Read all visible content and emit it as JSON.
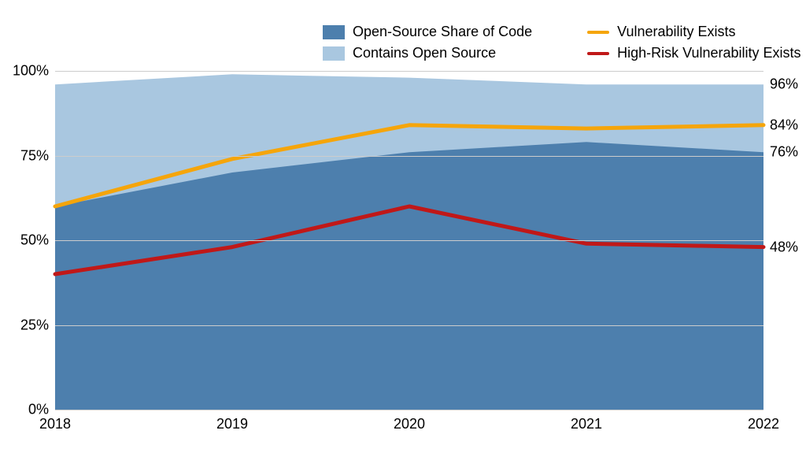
{
  "chart_data": {
    "type": "area",
    "x": [
      2018,
      2019,
      2020,
      2021,
      2022
    ],
    "series": [
      {
        "name": "Contains Open Source",
        "type": "area",
        "color": "#a9c7e0",
        "values": [
          96,
          99,
          98,
          96,
          96
        ]
      },
      {
        "name": "Open-Source Share of Code",
        "type": "area",
        "color": "#4d7fad",
        "values": [
          60,
          70,
          76,
          79,
          76
        ]
      },
      {
        "name": "Vulnerability Exists",
        "type": "line",
        "color": "#f5a50b",
        "values": [
          60,
          74,
          84,
          83,
          84
        ]
      },
      {
        "name": "High-Risk Vulnerability Exists",
        "type": "line",
        "color": "#c01818",
        "values": [
          40,
          48,
          60,
          49,
          48
        ]
      }
    ],
    "xlabel": "",
    "ylabel": "",
    "ylim": [
      0,
      100
    ],
    "xlim": [
      2018,
      2022
    ],
    "y_ticks": [
      0,
      25,
      50,
      75,
      100
    ],
    "y_tick_labels": [
      "0%",
      "25%",
      "50%",
      "75%",
      "100%"
    ],
    "x_tick_labels": [
      "2018",
      "2019",
      "2020",
      "2021",
      "2022"
    ],
    "end_labels": [
      {
        "value": 96,
        "label": "96%"
      },
      {
        "value": 84,
        "label": "84%"
      },
      {
        "value": 76,
        "label": "76%"
      },
      {
        "value": 48,
        "label": "48%"
      }
    ],
    "legend": {
      "col1": [
        {
          "label": "Open-Source Share of Code",
          "swatch": "area",
          "color": "#4d7fad"
        },
        {
          "label": "Contains Open Source",
          "swatch": "area",
          "color": "#a9c7e0"
        }
      ],
      "col2": [
        {
          "label": "Vulnerability Exists",
          "swatch": "line",
          "color": "#f5a50b"
        },
        {
          "label": "High-Risk Vulnerability Exists",
          "swatch": "line",
          "color": "#c01818"
        }
      ]
    }
  }
}
